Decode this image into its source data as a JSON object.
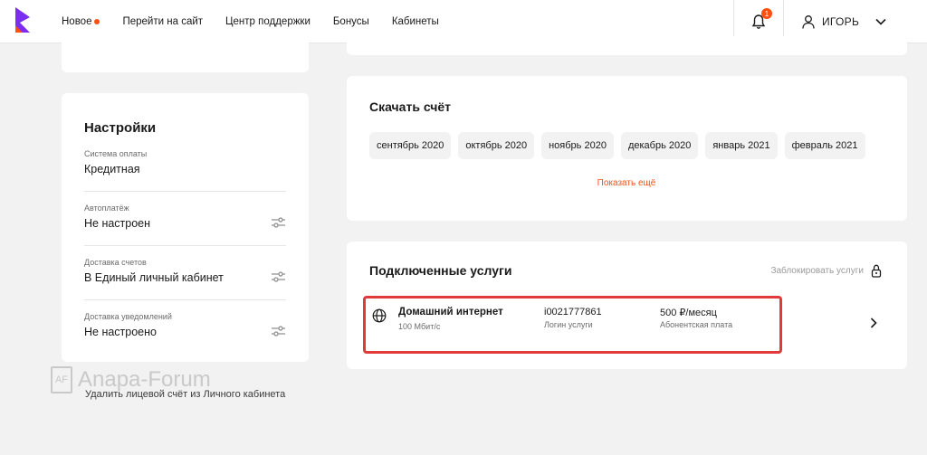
{
  "brand": {
    "accent": "#ff4f12",
    "logo_color": "#7b2df2"
  },
  "nav": {
    "new": "Новое",
    "site": "Перейти на сайт",
    "support": "Центр поддержки",
    "bonuses": "Бонусы",
    "cabinets": "Кабинеты"
  },
  "notifications": {
    "count": "1",
    "icon": "bell-icon"
  },
  "user": {
    "name": "ИГОРЬ",
    "icon": "user-icon"
  },
  "settings": {
    "title": "Настройки",
    "rows": [
      {
        "label": "Система оплаты",
        "value": "Кредитная"
      },
      {
        "label": "Автоплатёж",
        "value": "Не настроен"
      },
      {
        "label": "Доставка счетов",
        "value": "В Единый личный кабинет"
      },
      {
        "label": "Доставка уведомлений",
        "value": "Не настроено"
      }
    ]
  },
  "invoice": {
    "title": "Скачать счёт",
    "months": [
      "сентябрь 2020",
      "октябрь 2020",
      "ноябрь 2020",
      "декабрь 2020",
      "январь 2021",
      "февраль 2021"
    ],
    "show_more": "Показать ещё"
  },
  "services": {
    "title": "Подключенные услуги",
    "block_label": "Заблокировать услуги",
    "items": [
      {
        "name": "Домашний интернет",
        "speed": "100 Мбит/с",
        "login": "i0021777861",
        "login_label": "Логин услуги",
        "price": "500 ₽/месяц",
        "price_label": "Абонентская плата"
      }
    ]
  },
  "watermark": {
    "badge": "AF",
    "text": "Anapa-Forum"
  },
  "delete_account": "Удалить лицевой счёт из Личного кабинета"
}
